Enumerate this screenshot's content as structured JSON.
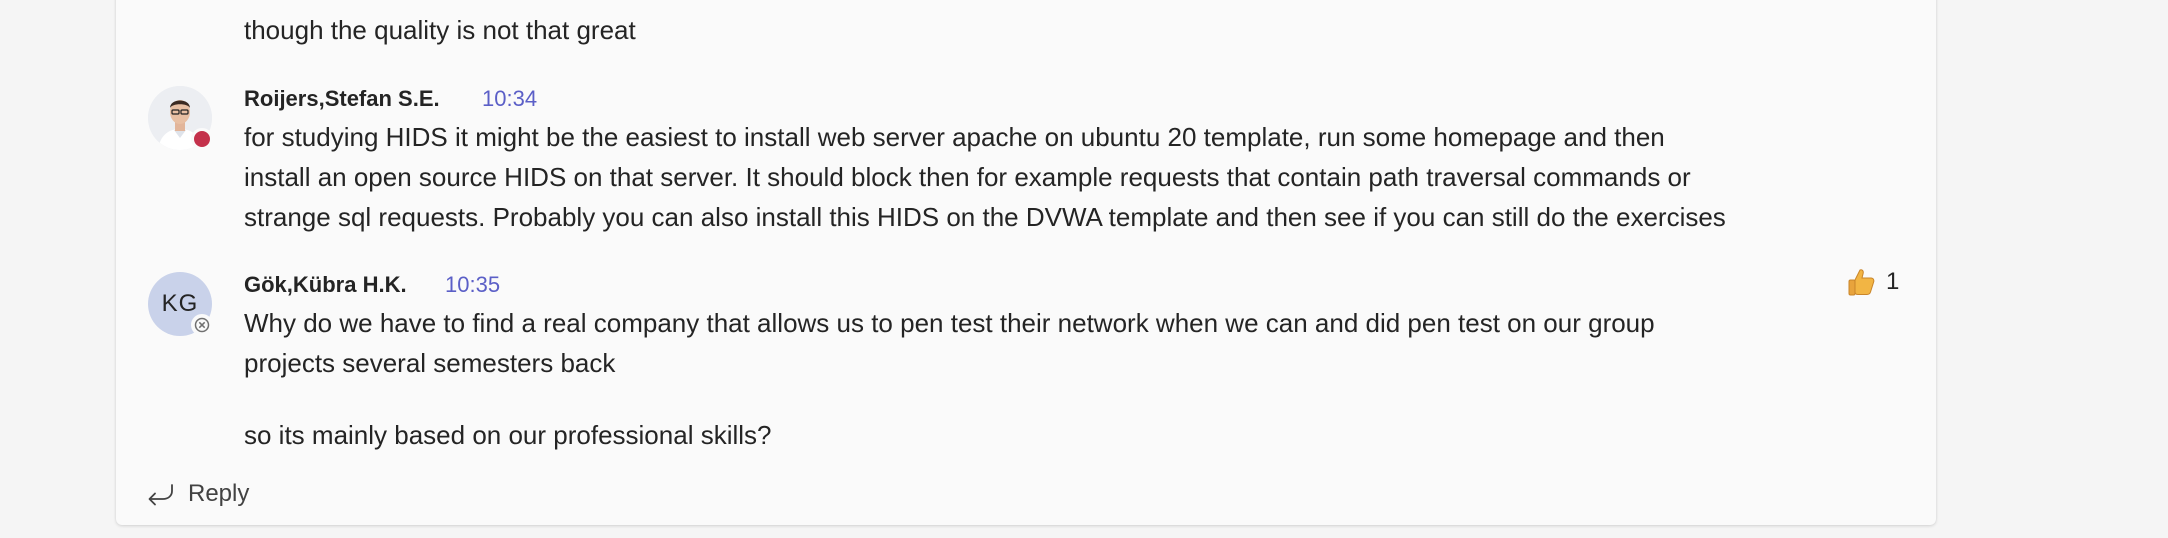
{
  "previous_message": {
    "text": "though the quality is not that great"
  },
  "messages": [
    {
      "author": "Roijers,Stefan S.E.",
      "time": "10:34",
      "presence": "busy",
      "lines": [
        "for studying HIDS it might be the easiest to install web server apache on ubuntu 20 template, run some homepage and then",
        "install an open source HIDS on that server. It should block then for example requests that contain path traversal commands or",
        "strange sql requests. Probably you can also install this HIDS on the DVWA template and then see if you can still do the exercises"
      ]
    },
    {
      "author": "Gök,Kübra H.K.",
      "initials": "KG",
      "time": "10:35",
      "presence": "offline",
      "lines": [
        "Why do we have to find a real company that allows us to pen test their network when we can and did pen test on our group",
        "projects several semesters back"
      ],
      "followup": "so its mainly based on our professional skills?",
      "reaction": {
        "icon": "thumbs-up-icon",
        "count": "1"
      }
    }
  ],
  "reply": {
    "label": "Reply"
  },
  "colors": {
    "accent_time": "#5b5fc7",
    "busy": "#c4314b",
    "thumb": "#e8a33c"
  }
}
